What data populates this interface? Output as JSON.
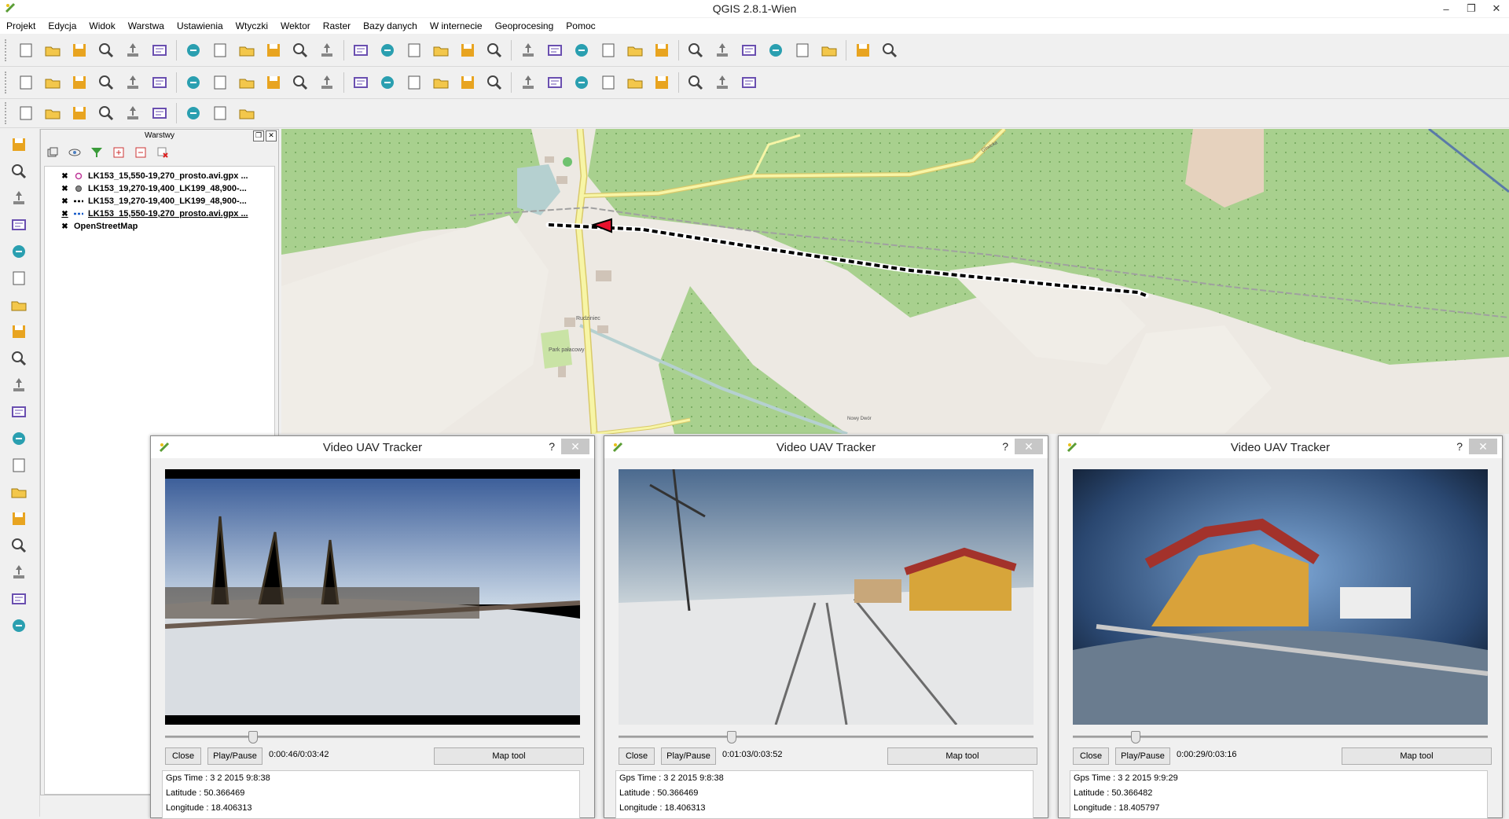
{
  "window": {
    "title": "QGIS 2.8.1-Wien",
    "controls": [
      "–",
      "❐",
      "✕"
    ]
  },
  "menu": [
    "Projekt",
    "Edycja",
    "Widok",
    "Warstwa",
    "Ustawienia",
    "Wtyczki",
    "Wektor",
    "Raster",
    "Bazy danych",
    "W internecie",
    "Geoprocesing",
    "Pomoc"
  ],
  "toolbar1_icons": [
    "new-project-icon",
    "open-project-icon",
    "save-project-icon",
    "save-as-icon",
    "new-print-composer-icon",
    "composer-manager-icon",
    "pan-selection-icon",
    "pan-icon",
    "pan-to-selection-icon",
    "zoom-in-icon",
    "zoom-out-icon",
    "zoom-actual-icon",
    "zoom-full-icon",
    "zoom-selection-icon",
    "zoom-layer-icon",
    "zoom-last-icon",
    "zoom-next-icon",
    "refresh-icon",
    "identify-icon",
    "action-icon",
    "select-icon",
    "deselect-icon",
    "expression-select-icon",
    "attribute-table-icon",
    "field-calculator-icon",
    "measure-icon",
    "map-tips-icon",
    "bookmark-icon",
    "show-bookmarks-icon",
    "text-annotation-icon",
    "help-icon",
    "whats-this-icon"
  ],
  "toolbar2_icons": [
    "current-edits-icon",
    "toggle-editing-icon",
    "save-edits-icon",
    "add-feature-icon",
    "move-feature-icon",
    "node-tool-icon",
    "delete-selected-icon",
    "cut-features-icon",
    "copy-features-icon",
    "paste-features-icon",
    "label-icon",
    "label-highlight-icon",
    "pin-labels-icon",
    "show-hide-labels-icon",
    "move-label-icon",
    "rotate-label-icon",
    "change-label-icon",
    "grass-icon",
    "grass-tools-icon",
    "openlayers-icon",
    "db-manager-icon",
    "georeferencer-icon",
    "spatialite-icon",
    "csw-icon",
    "python-icon",
    "processing-icon",
    "video-uav-icon"
  ],
  "toolbar3_icons": [
    "add-vector-icon",
    "add-raster-icon",
    "add-postgis-icon",
    "new-shapefile-icon",
    "add-spatialite-icon",
    "add-wms-icon",
    "digitize-icon",
    "add-wcs-icon",
    "add-wfs-icon"
  ],
  "left_toolbar_icons": [
    "add-vector-layer-icon",
    "add-raster-layer-icon",
    "add-postgis-layer-icon",
    "add-spatialite-layer-icon",
    "add-mssql-layer-icon",
    "add-oracle-layer-icon",
    "add-wms-layer-icon",
    "add-wcs-layer-icon",
    "add-wfs-layer-icon",
    "add-delimited-text-icon",
    "new-shapefile-layer-icon",
    "new-spatialite-layer-icon",
    "add-virtual-layer-icon",
    "gps-tools-icon",
    "coordinate-capture-icon",
    "offline-editing-icon",
    "raster-calculator-icon",
    "heatmap-icon",
    "georef-icon"
  ],
  "layers_panel": {
    "title": "Warstwy",
    "layers": [
      {
        "name": "LK153_15,550-19,270_prosto.avi.gpx ...",
        "symbol": "circle-pink"
      },
      {
        "name": "LK153_19,270-19,400_LK199_48,900-...",
        "symbol": "circle-gray"
      },
      {
        "name": "LK153_19,270-19,400_LK199_48,900-...",
        "symbol": "line-dash"
      },
      {
        "name": "LK153_15,550-19,270_prosto.avi.gpx ...",
        "symbol": "line-dash-blue"
      },
      {
        "name": "OpenStreetMap",
        "symbol": "none"
      }
    ]
  },
  "map": {
    "labels": [
      "Rudziniec",
      "Park pałacowy",
      "Nowy Dwór",
      "Gliwicka"
    ],
    "colors": {
      "forest": "#a8d08e",
      "land": "#ede9e3",
      "road_major": "#f7f5a6",
      "road_outline": "#d9c96a",
      "water": "#b5d0d0",
      "track": "#000000",
      "marker": "#e8112d"
    }
  },
  "video_dialogs": [
    {
      "title": "Video UAV Tracker",
      "close_label": "Close",
      "play_label": "Play/Pause",
      "time": "0:00:46/0:03:42",
      "map_label": "Map tool",
      "gps_time": "Gps Time : 3 2 2015 9:8:38",
      "latitude": "Latitude : 50.366469",
      "longitude": "Longitude : 18.406313",
      "progress": 0.21
    },
    {
      "title": "Video UAV Tracker",
      "close_label": "Close",
      "play_label": "Play/Pause",
      "time": "0:01:03/0:03:52",
      "map_label": "Map tool",
      "gps_time": "Gps Time : 3 2 2015 9:8:38",
      "latitude": "Latitude : 50.366469",
      "longitude": "Longitude : 18.406313",
      "progress": 0.27
    },
    {
      "title": "Video UAV Tracker",
      "close_label": "Close",
      "play_label": "Play/Pause",
      "time": "0:00:29/0:03:16",
      "map_label": "Map tool",
      "gps_time": "Gps Time : 3 2 2015 9:9:29",
      "latitude": "Latitude : 50.366482",
      "longitude": "Longitude : 18.405797",
      "progress": 0.15
    }
  ]
}
